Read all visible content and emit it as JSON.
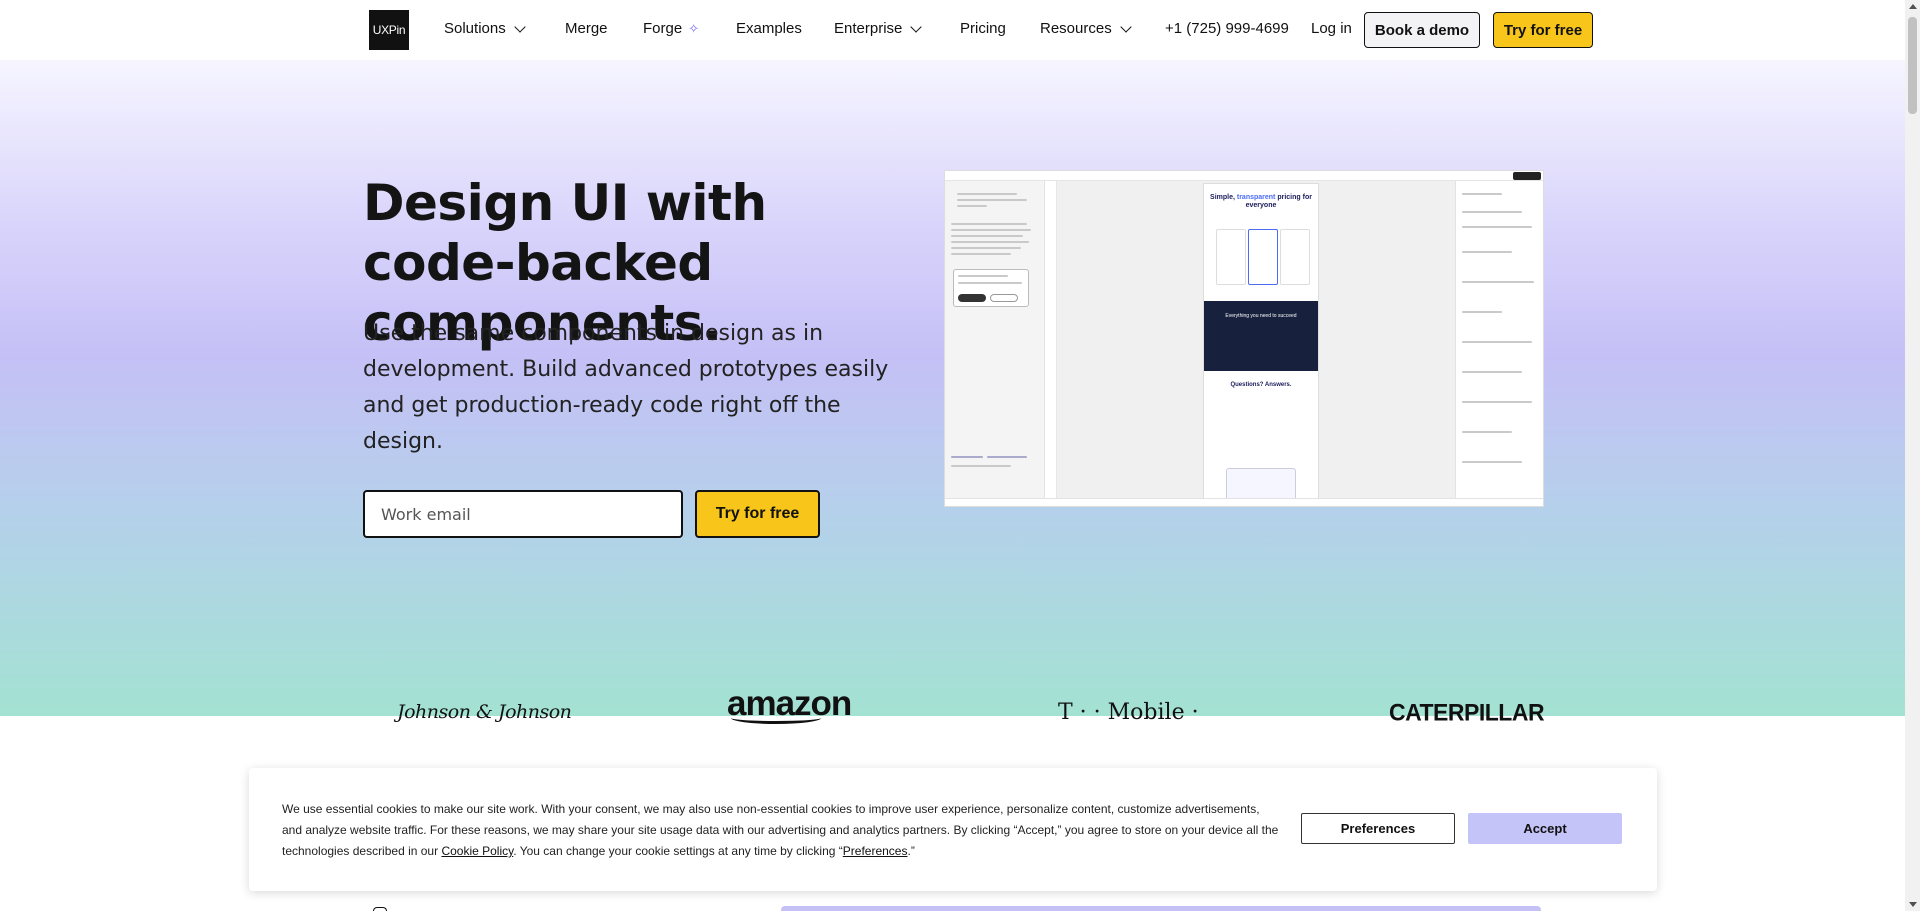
{
  "header": {
    "logo": "UXPin",
    "nav": [
      {
        "label": "Solutions",
        "dropdown": true
      },
      {
        "label": "Merge"
      },
      {
        "label": "Forge",
        "icon": "sparkle-icon"
      },
      {
        "label": "Examples"
      },
      {
        "label": "Enterprise",
        "dropdown": true
      },
      {
        "label": "Pricing"
      },
      {
        "label": "Resources",
        "dropdown": true
      }
    ],
    "phone": "+1 (725) 999-4699",
    "login": "Log in",
    "book_demo": "Book a demo",
    "try_free": "Try for free"
  },
  "hero": {
    "title": "Design UI with code-backed components.",
    "subtitle": "Use the same components in design as in development. Build advanced prototypes easily and get production-ready code right off the design.",
    "email_placeholder": "Work email",
    "cta": "Try for free"
  },
  "preview": {
    "page_title_a": "Simple, ",
    "page_title_b": "transparent",
    "page_title_c": " pricing for everyone",
    "dark_band_title": "Everything you need to succeed",
    "faq_title": "Questions? Answers."
  },
  "logos": [
    "Johnson & Johnson",
    "amazon",
    "T · · Mobile ·",
    "CATERPILLAR"
  ],
  "cookie": {
    "text_1": "We use essential cookies to make our site work. With your consent, we may also use non-essential cookies to improve user experience, personalize content, customize advertisements, and analyze website traffic. For these reasons, we may share your site usage data with our advertising and analytics partners. By clicking “Accept,” you agree to store on your device all the technologies described in our ",
    "policy_link": "Cookie Policy",
    "text_2": ". You can change your cookie settings at any time by clicking “",
    "pref_link": "Preferences",
    "text_3": ".”",
    "preferences_button": "Preferences",
    "accept_button": "Accept"
  },
  "colors": {
    "accent_yellow": "#f8c61b",
    "accept_lavender": "#c5c4f8",
    "gradient_top": "#f6f5ff",
    "gradient_mid": "#c5c0f6",
    "gradient_bottom": "#a3e2d2"
  }
}
